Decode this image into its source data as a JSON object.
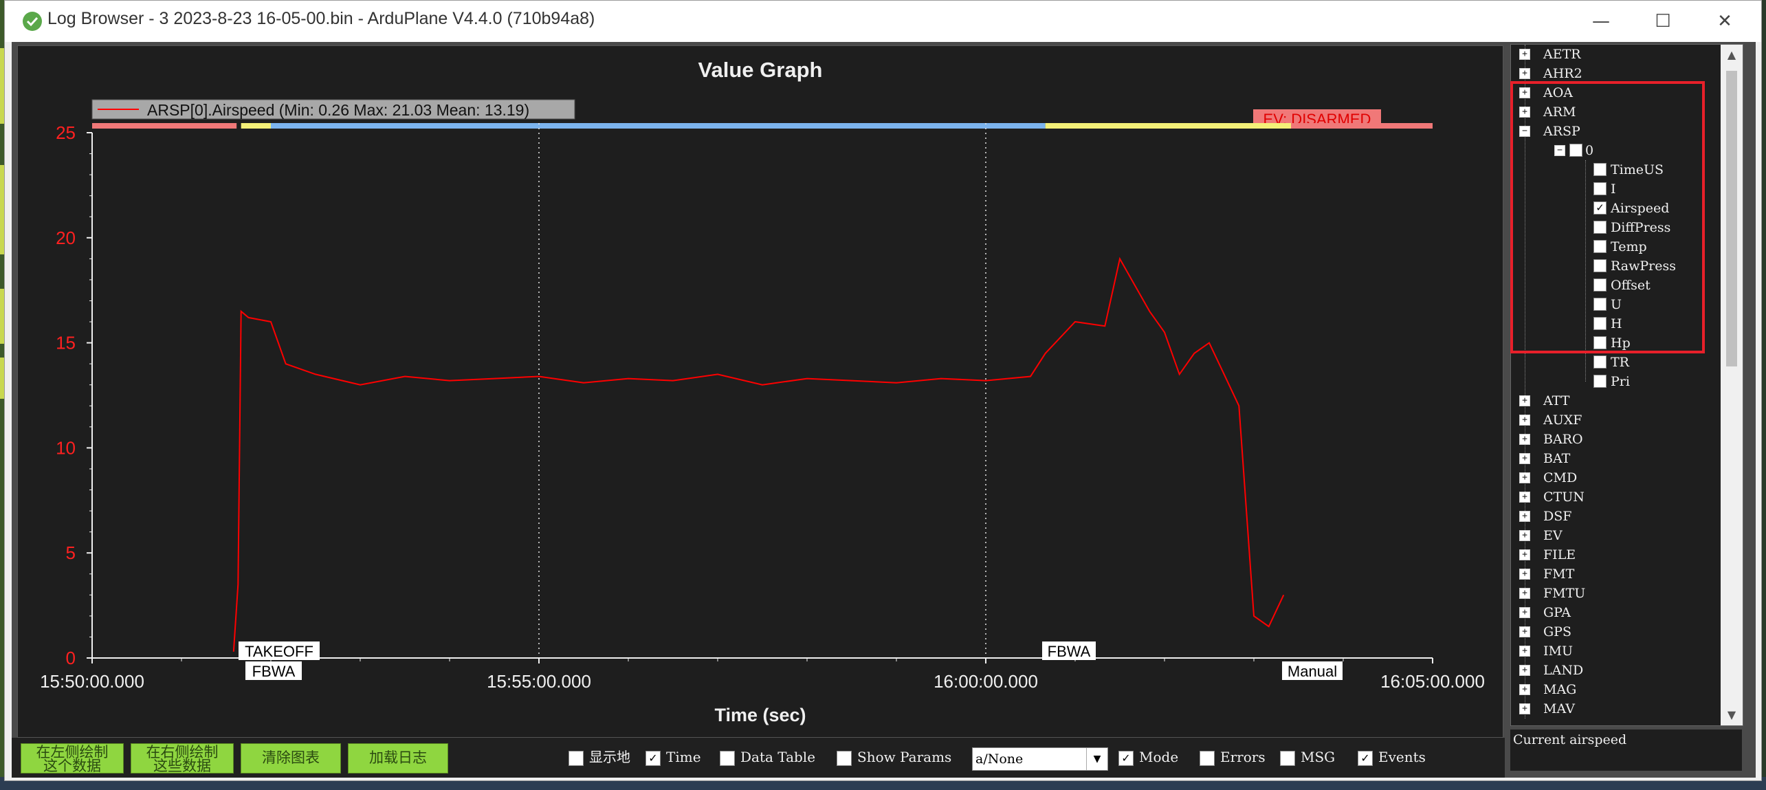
{
  "window": {
    "title": "Log Browser - 3 2023-8-23 16-05-00.bin - ArduPlane V4.4.0 (710b94a8)",
    "minimize": "—",
    "maximize": "☐",
    "close": "✕"
  },
  "graph": {
    "title": "Value Graph",
    "legend": "ARSP[0].Airspeed  (Min: 0.26 Max: 21.03 Mean: 13.19)",
    "xlabel": "Time (sec)",
    "event_label": "EV: DISARMED",
    "mode_labels_top": [
      "TAKEOFF",
      "FBWA"
    ],
    "mode_labels_bottom": [
      "FBWA",
      "Manual"
    ],
    "colors": {
      "series": "#ff0000",
      "axis_text": "#ff2020",
      "blue": "#7cb4ee",
      "yellow": "#f4f078",
      "pink": "#f07878"
    }
  },
  "chart_data": {
    "type": "line",
    "title": "Value Graph",
    "xlabel": "Time (sec)",
    "ylabel": "",
    "x_ticks": [
      "15:50:00.000",
      "15:55:00.000",
      "16:00:00.000",
      "16:05:00.000"
    ],
    "y_ticks": [
      "0",
      "5",
      "10",
      "15",
      "20",
      "25"
    ],
    "ylim": [
      0,
      25
    ],
    "xlim": [
      "15:50:00",
      "16:05:00"
    ],
    "series": [
      {
        "name": "ARSP[0].Airspeed  (Min: 0.26 Max: 21.03 Mean: 13.19)",
        "color": "#ff0000",
        "x": [
          "15:51:35",
          "15:51:38",
          "15:51:40",
          "15:51:45",
          "15:52:00",
          "15:52:10",
          "15:52:30",
          "15:53:00",
          "15:53:30",
          "15:54:00",
          "15:54:30",
          "15:55:00",
          "15:55:30",
          "15:56:00",
          "15:56:30",
          "15:57:00",
          "15:57:30",
          "15:58:00",
          "15:58:30",
          "15:59:00",
          "15:59:30",
          "16:00:00",
          "16:00:30",
          "16:00:40",
          "16:01:00",
          "16:01:20",
          "16:01:30",
          "16:01:50",
          "16:02:00",
          "16:02:10",
          "16:02:20",
          "16:02:30",
          "16:02:40",
          "16:02:50",
          "16:03:00",
          "16:03:10",
          "16:03:20"
        ],
        "values": [
          0.3,
          3.5,
          16.5,
          16.2,
          16.0,
          14.0,
          13.5,
          13.0,
          13.4,
          13.2,
          13.3,
          13.4,
          13.1,
          13.3,
          13.2,
          13.5,
          13.0,
          13.3,
          13.2,
          13.1,
          13.3,
          13.2,
          13.4,
          14.5,
          16.0,
          15.8,
          19.0,
          16.5,
          15.5,
          13.5,
          14.5,
          15.0,
          13.5,
          12.0,
          2.0,
          1.5,
          3.0
        ]
      }
    ],
    "mode_bands": [
      {
        "label": "TAKEOFF",
        "color": "#f07878",
        "from": "15:50:00",
        "to": "15:51:37"
      },
      {
        "label": "FBWA",
        "color": "#f4f078",
        "from": "15:51:40",
        "to": "15:52:00"
      },
      {
        "label": "",
        "color": "#7cb4ee",
        "from": "15:52:00",
        "to": "16:00:40"
      },
      {
        "label": "FBWA",
        "color": "#f4f078",
        "from": "16:00:40",
        "to": "16:03:25"
      },
      {
        "label": "Manual",
        "color": "#f07878",
        "from": "16:03:25",
        "to": "16:05:00"
      }
    ],
    "grid": "vertical dotted at major ticks",
    "legend_position": "top-left"
  },
  "tree": {
    "items_before": [
      "AETR",
      "AHR2",
      "AOA",
      "ARM"
    ],
    "expanded": {
      "label": "ARSP",
      "instance": "0",
      "fields": [
        {
          "label": "TimeUS",
          "checked": false
        },
        {
          "label": "I",
          "checked": false
        },
        {
          "label": "Airspeed",
          "checked": true
        },
        {
          "label": "DiffPress",
          "checked": false
        },
        {
          "label": "Temp",
          "checked": false
        },
        {
          "label": "RawPress",
          "checked": false
        },
        {
          "label": "Offset",
          "checked": false
        },
        {
          "label": "U",
          "checked": false
        },
        {
          "label": "H",
          "checked": false
        },
        {
          "label": "Hp",
          "checked": false
        },
        {
          "label": "TR",
          "checked": false
        },
        {
          "label": "Pri",
          "checked": false
        }
      ]
    },
    "items_after": [
      "ATT",
      "AUXF",
      "BARO",
      "BAT",
      "CMD",
      "CTUN",
      "DSF",
      "EV",
      "FILE",
      "FMT",
      "FMTU",
      "GPA",
      "GPS",
      "IMU",
      "LAND",
      "MAG",
      "MAV"
    ],
    "description": "Current airspeed"
  },
  "bottom": {
    "buttons": [
      {
        "line1": "在左侧绘制",
        "line2": "这个数据"
      },
      {
        "line1": "在右侧绘制",
        "line2": "这些数据"
      },
      {
        "line1": "清除图表",
        "line2": ""
      },
      {
        "line1": "加载日志",
        "line2": ""
      }
    ],
    "options": [
      {
        "label": "显示地",
        "checked": false
      },
      {
        "label": "Time",
        "checked": true
      },
      {
        "label": "Data Table",
        "checked": false
      },
      {
        "label": "Show Params",
        "checked": false
      },
      {
        "label": "Mode",
        "checked": true
      },
      {
        "label": "Errors",
        "checked": false
      },
      {
        "label": "MSG",
        "checked": false
      },
      {
        "label": "Events",
        "checked": true
      }
    ],
    "combo_value": "a/None"
  }
}
